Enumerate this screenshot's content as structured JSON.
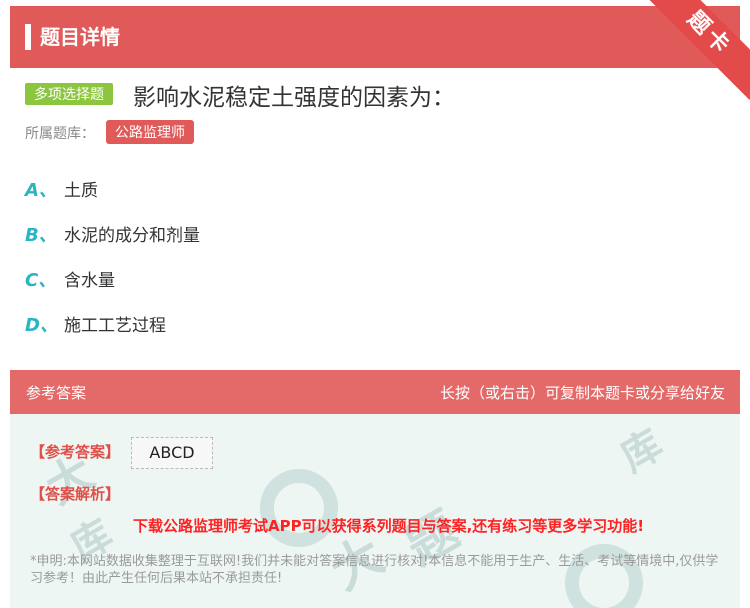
{
  "header": {
    "title": "题目详情",
    "ribbon": "题卡"
  },
  "question": {
    "type_badge": "多项选择题",
    "text": "影响水泥稳定土强度的因素为：",
    "category_label": "所属题库：",
    "category_tag": "公路监理师"
  },
  "options": [
    {
      "letter": "A、",
      "text": "土质"
    },
    {
      "letter": "B、",
      "text": "水泥的成分和剂量"
    },
    {
      "letter": "C、",
      "text": "含水量"
    },
    {
      "letter": "D、",
      "text": "施工工艺过程"
    }
  ],
  "answer_section": {
    "header_label": "参考答案",
    "header_note": "长按（或右击）可复制本题卡或分享给好友",
    "answer_label": "【参考答案】",
    "answer_value": "ABCD",
    "analysis_label": "【答案解析】",
    "promo": "下载公路监理师考试APP可以获得系列题目与答案,还有练习等更多学习功能!",
    "disclaimer": "*申明:本网站数据收集整理于互联网!我们并未能对答案信息进行核对!本信息不能用于生产、生活、考试等情境中,仅供学习参考！由此产生任何后果本站不承担责任!"
  },
  "colors": {
    "header_red": "#e05a5a",
    "option_letter": "#29b5c4",
    "type_badge": "#8cc63f",
    "answer_red": "#e0504a",
    "promo_red": "#ff2222"
  }
}
